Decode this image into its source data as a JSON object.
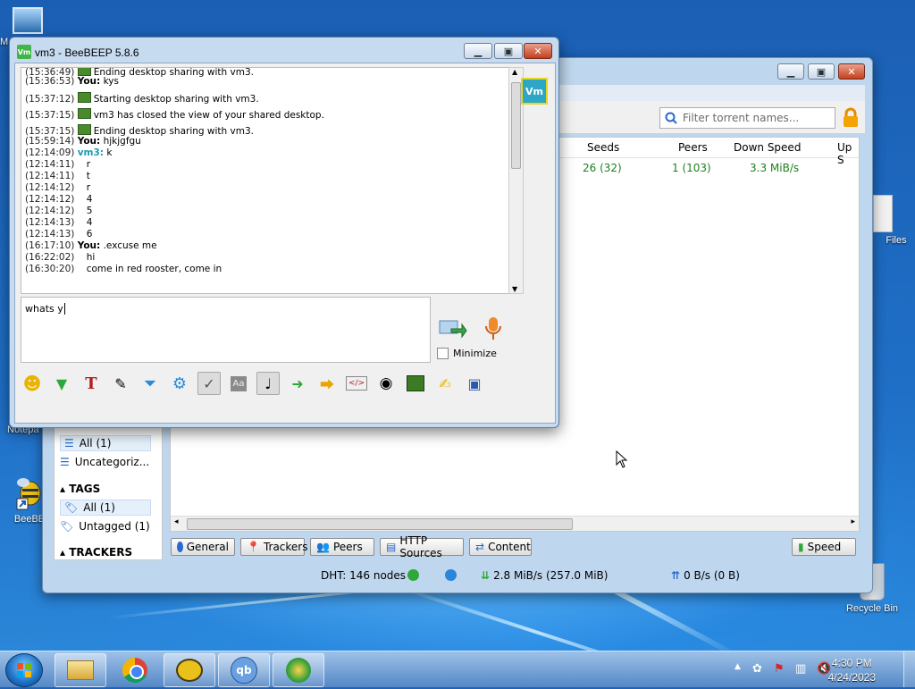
{
  "desktop": {
    "icons": [
      {
        "label": "M"
      },
      {
        "label": "Files"
      },
      {
        "label": "Notepa"
      },
      {
        "label": "BeeBE"
      },
      {
        "label": "Recycle Bin"
      }
    ]
  },
  "qbittorrent": {
    "filter_placeholder": "Filter torrent names...",
    "columns": {
      "seeds": "Seeds",
      "peers": "Peers",
      "down": "Down Speed",
      "up": "Up S"
    },
    "row": {
      "seeds": "26 (32)",
      "peers": "1 (103)",
      "down": "3.3 MiB/s"
    },
    "sidebar": {
      "status_all": "All (1)",
      "uncategorized": "Uncategoriz...",
      "tags_head": "TAGS",
      "tags_all": "All (1)",
      "untagged": "Untagged (1)",
      "trackers_head": "TRACKERS"
    },
    "tabs": {
      "general": "General",
      "trackers": "Trackers",
      "peers": "Peers",
      "http": "HTTP Sources",
      "content": "Content",
      "speed": "Speed"
    },
    "status": {
      "dht": "DHT: 146 nodes",
      "down": "2.8 MiB/s (257.0 MiB)",
      "up": "0 B/s (0 B)"
    }
  },
  "beebeep": {
    "title": "vm3 - BeeBEEP 5.8.6",
    "app_icon": "Vm",
    "badge": "Vm",
    "messages": [
      {
        "ts": "(15:36:49)",
        "sender": "",
        "text": "Ending desktop sharing with vm3."
      },
      {
        "ts": "(15:36:53)",
        "sender": "You:",
        "text": "kys"
      },
      {
        "ts": "(15:37:12)",
        "sender": "",
        "text": "Starting desktop sharing with vm3."
      },
      {
        "ts": "(15:37:15)",
        "sender": "",
        "text": "vm3 has closed the view of your shared desktop."
      },
      {
        "ts": "(15:37:15)",
        "sender": "",
        "text": "Ending desktop sharing with vm3."
      },
      {
        "ts": "(15:59:14)",
        "sender": "You:",
        "text": "hjkjgfgu"
      },
      {
        "ts": "(12:14:09)",
        "sender": "vm3:",
        "text": "k"
      },
      {
        "ts": "(12:14:11)",
        "sender": "",
        "text": "r"
      },
      {
        "ts": "(12:14:11)",
        "sender": "",
        "text": "t"
      },
      {
        "ts": "(12:14:12)",
        "sender": "",
        "text": "r"
      },
      {
        "ts": "(12:14:12)",
        "sender": "",
        "text": "4"
      },
      {
        "ts": "(12:14:12)",
        "sender": "",
        "text": "5"
      },
      {
        "ts": "(12:14:13)",
        "sender": "",
        "text": "4"
      },
      {
        "ts": "(12:14:13)",
        "sender": "",
        "text": "6"
      },
      {
        "ts": "(16:17:10)",
        "sender": "You:",
        "text": ".excuse me"
      },
      {
        "ts": "(16:22:02)",
        "sender": "",
        "text": "hi"
      },
      {
        "ts": "(16:30:20)",
        "sender": "",
        "text": "come in red rooster, come in"
      }
    ],
    "input_value": "whats y",
    "minimize_label": "Minimize"
  },
  "taskbar": {
    "time": "4:30 PM",
    "date": "4/24/2023"
  }
}
